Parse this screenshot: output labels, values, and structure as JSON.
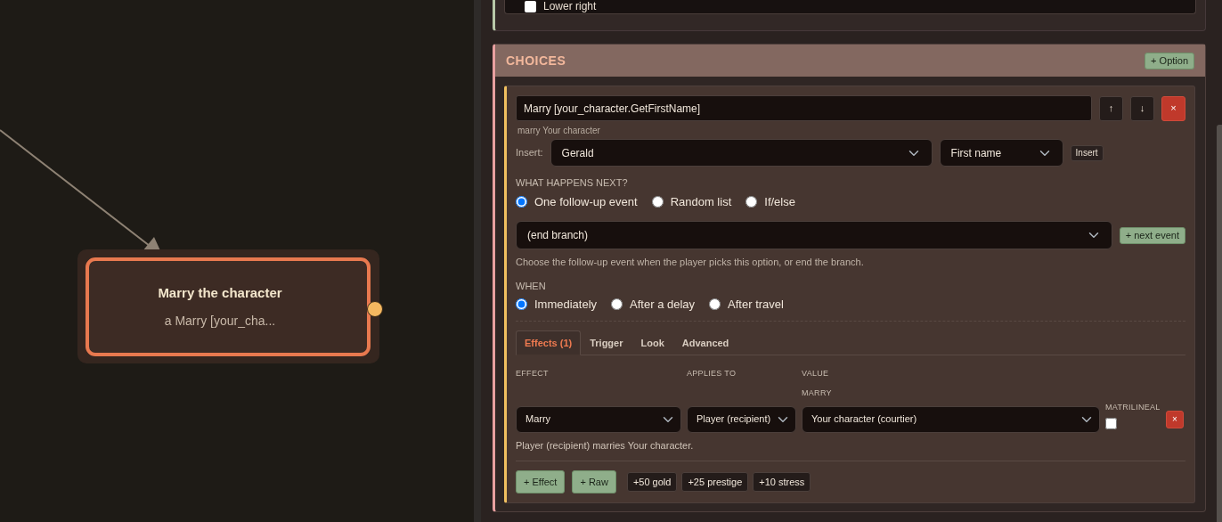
{
  "canvas": {
    "node": {
      "title": "Marry the character",
      "subtitle": "a Marry [your_cha...",
      "selected": true
    }
  },
  "top_section": {
    "options": [
      {
        "label": "Lower right",
        "checked": false
      }
    ]
  },
  "choices": {
    "title": "CHOICES",
    "add_button": "+ Option",
    "options": [
      {
        "text_value": "Marry [your_character.GetFirstName]",
        "move_buttons": [
          "↑",
          "↓"
        ],
        "delete_button": "×",
        "hint": "marry Your character",
        "insert": {
          "label": "Insert:",
          "character": "Gerald",
          "part": "First name",
          "button": "Insert"
        },
        "next": {
          "heading": "WHAT HAPPENS NEXT?",
          "modes": [
            {
              "label": "One follow-up event",
              "selected": true
            },
            {
              "label": "Random list",
              "selected": false
            },
            {
              "label": "If/else",
              "selected": false
            }
          ],
          "event_value": "(end branch)",
          "add_button": "+ next event",
          "help": "Choose the follow-up event when the player picks this option, or end the branch."
        },
        "when": {
          "heading": "WHEN",
          "modes": [
            {
              "label": "Immediately",
              "selected": true
            },
            {
              "label": "After a delay",
              "selected": false
            },
            {
              "label": "After travel",
              "selected": false
            }
          ]
        },
        "tabs": [
          {
            "label": "Effects (1)",
            "selected": true
          },
          {
            "label": "Trigger",
            "selected": false
          },
          {
            "label": "Look",
            "selected": false
          },
          {
            "label": "Advanced",
            "selected": false
          }
        ],
        "effects": {
          "columns": [
            "EFFECT",
            "APPLIES TO",
            "VALUE"
          ],
          "rows": [
            {
              "effect": "Marry",
              "applies_to": "Player (recipient)",
              "value_label": "MARRY",
              "value": "Your character (courtier)",
              "flag_label": "MATRILINEAL",
              "flag_checked": false,
              "delete_button": "×",
              "summary": "Player (recipient) marries Your character."
            }
          ]
        },
        "buttons": [
          "+ Effect",
          "+ Raw"
        ],
        "presets": [
          "+50 gold",
          "+25 prestige",
          "+10 stress"
        ]
      }
    ]
  }
}
